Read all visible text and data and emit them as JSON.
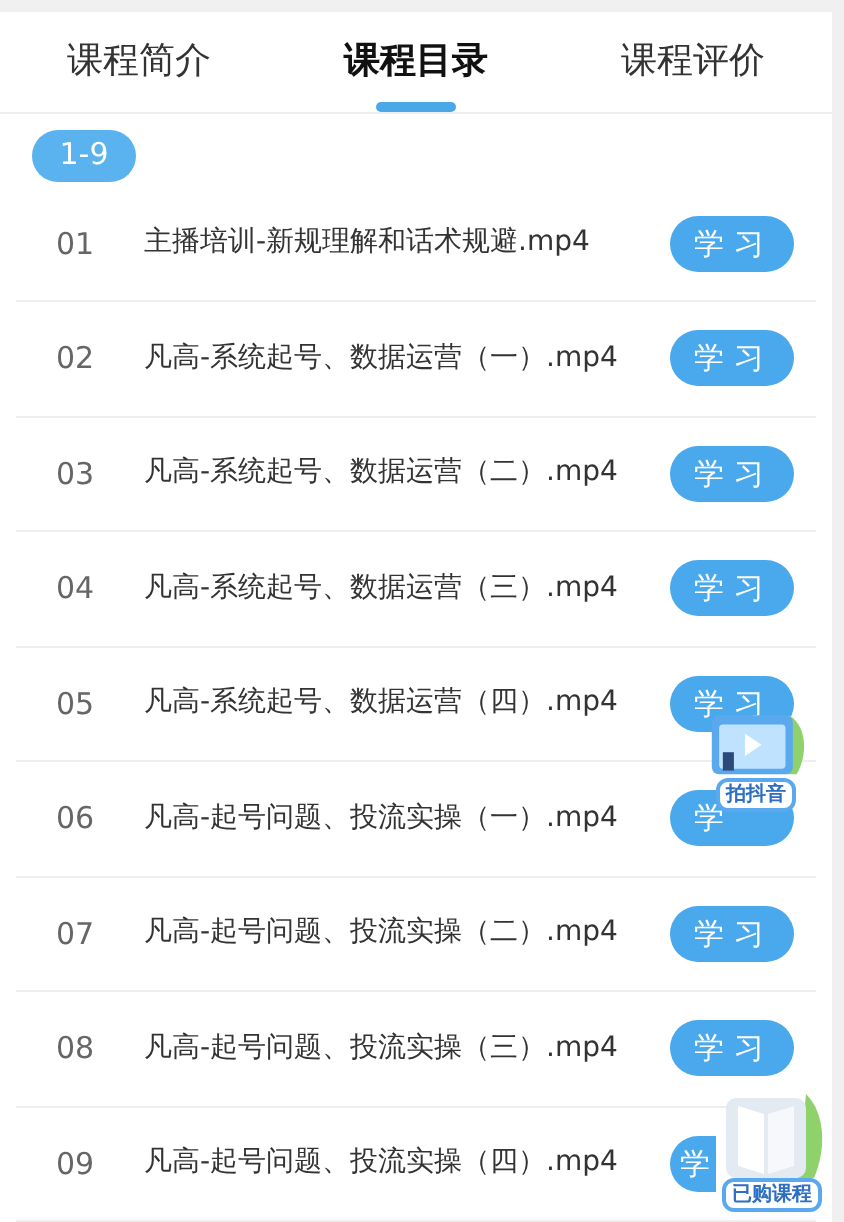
{
  "tabs": [
    {
      "label": "课程简介",
      "selected": false
    },
    {
      "label": "课程目录",
      "selected": true
    },
    {
      "label": "课程评价",
      "selected": false
    }
  ],
  "range_chip": "1-9",
  "lessons": [
    {
      "number": "01",
      "title": "主播培训-新规理解和话术规避.mp4",
      "button": "学 习"
    },
    {
      "number": "02",
      "title": "凡高-系统起号、数据运营（一）.mp4",
      "button": "学 习"
    },
    {
      "number": "03",
      "title": "凡高-系统起号、数据运营（二）.mp4",
      "button": "学 习"
    },
    {
      "number": "04",
      "title": "凡高-系统起号、数据运营（三）.mp4",
      "button": "学 习"
    },
    {
      "number": "05",
      "title": "凡高-系统起号、数据运营（四）.mp4",
      "button": "学 习"
    },
    {
      "number": "06",
      "title": "凡高-起号问题、投流实操（一）.mp4",
      "button": "学"
    },
    {
      "number": "07",
      "title": "凡高-起号问题、投流实操（二）.mp4",
      "button": "学 习"
    },
    {
      "number": "08",
      "title": "凡高-起号问题、投流实操（三）.mp4",
      "button": "学 习"
    },
    {
      "number": "09",
      "title": "凡高-起号问题、投流实操（四）.mp4",
      "button": "学",
      "button_covered": true
    }
  ],
  "floating_badges": [
    {
      "kind": "video",
      "label": "拍抖音"
    },
    {
      "kind": "book",
      "label": "已购课程"
    }
  ]
}
